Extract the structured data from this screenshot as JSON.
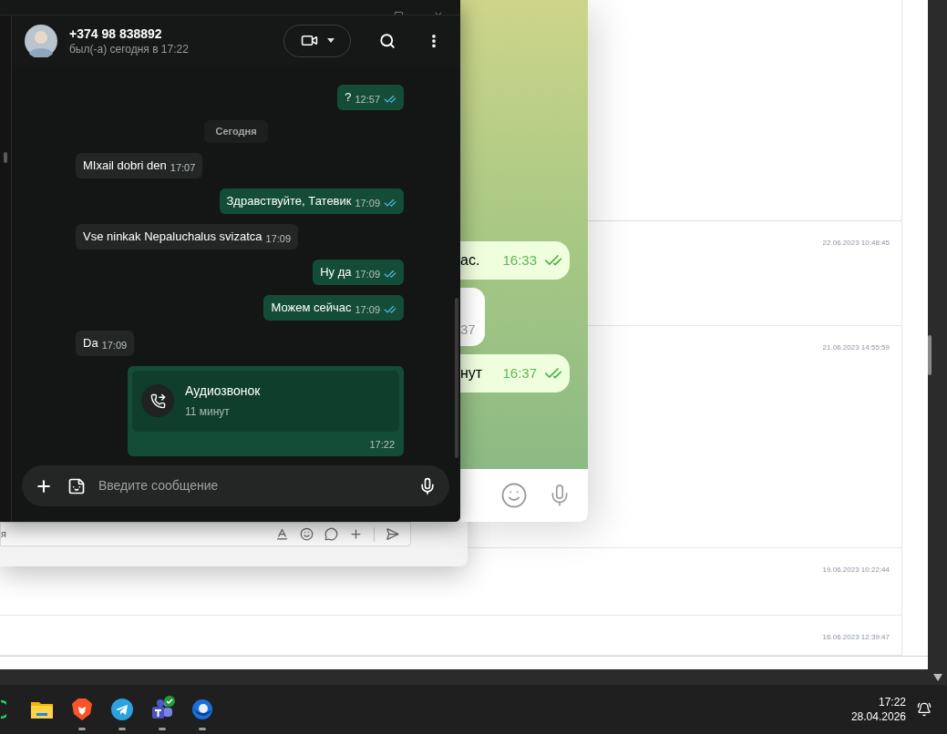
{
  "page": {
    "rows": [
      {
        "timestamp": "22.06.2023 10:48:45"
      },
      {
        "timestamp": "21.06.2023 14:55:59"
      },
      {
        "timestamp": "19.06.2023 10:22:44"
      },
      {
        "timestamp": "16.06.2023 12:39:47"
      }
    ]
  },
  "compose_window": {
    "text": "я"
  },
  "telegram_window": {
    "messages": [
      {
        "outgoing": true,
        "text": "ас.",
        "time": "16:33"
      },
      {
        "outgoing": false,
        "time": "37"
      },
      {
        "outgoing": true,
        "text": "нут",
        "time": "16:37"
      }
    ]
  },
  "chat_window": {
    "contact": {
      "name": "+374 98 838892",
      "status": "был(-а) сегодня в 17:22"
    },
    "messages": [
      {
        "kind": "text",
        "outgoing": true,
        "text": "?",
        "time": "12:57",
        "read": true
      },
      {
        "kind": "date",
        "text": "Сегодня"
      },
      {
        "kind": "text",
        "outgoing": false,
        "text": "MIxail dobri den",
        "time": "17:07"
      },
      {
        "kind": "text",
        "outgoing": true,
        "text": "Здравствуйте, Татевик",
        "time": "17:09",
        "read": true
      },
      {
        "kind": "text",
        "outgoing": false,
        "text": "Vse ninkak Nepaluchalus svizatca",
        "time": "17:09"
      },
      {
        "kind": "text",
        "outgoing": true,
        "text": "Ну да",
        "time": "17:09",
        "read": true
      },
      {
        "kind": "text",
        "outgoing": true,
        "text": "Можем сейчас",
        "time": "17:09",
        "read": true
      },
      {
        "kind": "text",
        "outgoing": false,
        "text": "Da",
        "time": "17:09"
      },
      {
        "kind": "call",
        "outgoing": true,
        "title": "Аудиозвонок",
        "duration": "11 минут",
        "time": "17:22"
      }
    ],
    "composer": {
      "placeholder": "Введите сообщение"
    }
  },
  "taskbar": {
    "apps": [
      {
        "kind": "ring",
        "running": false,
        "badge": false
      },
      {
        "kind": "folder",
        "running": false,
        "badge": false
      },
      {
        "kind": "shield",
        "running": true,
        "badge": false
      },
      {
        "kind": "plane",
        "running": true,
        "badge": false
      },
      {
        "kind": "team",
        "running": true,
        "badge": true
      },
      {
        "kind": "mail",
        "running": true,
        "badge": false
      }
    ],
    "clock": {
      "time": "17:22",
      "date": "28.04.2026"
    }
  }
}
